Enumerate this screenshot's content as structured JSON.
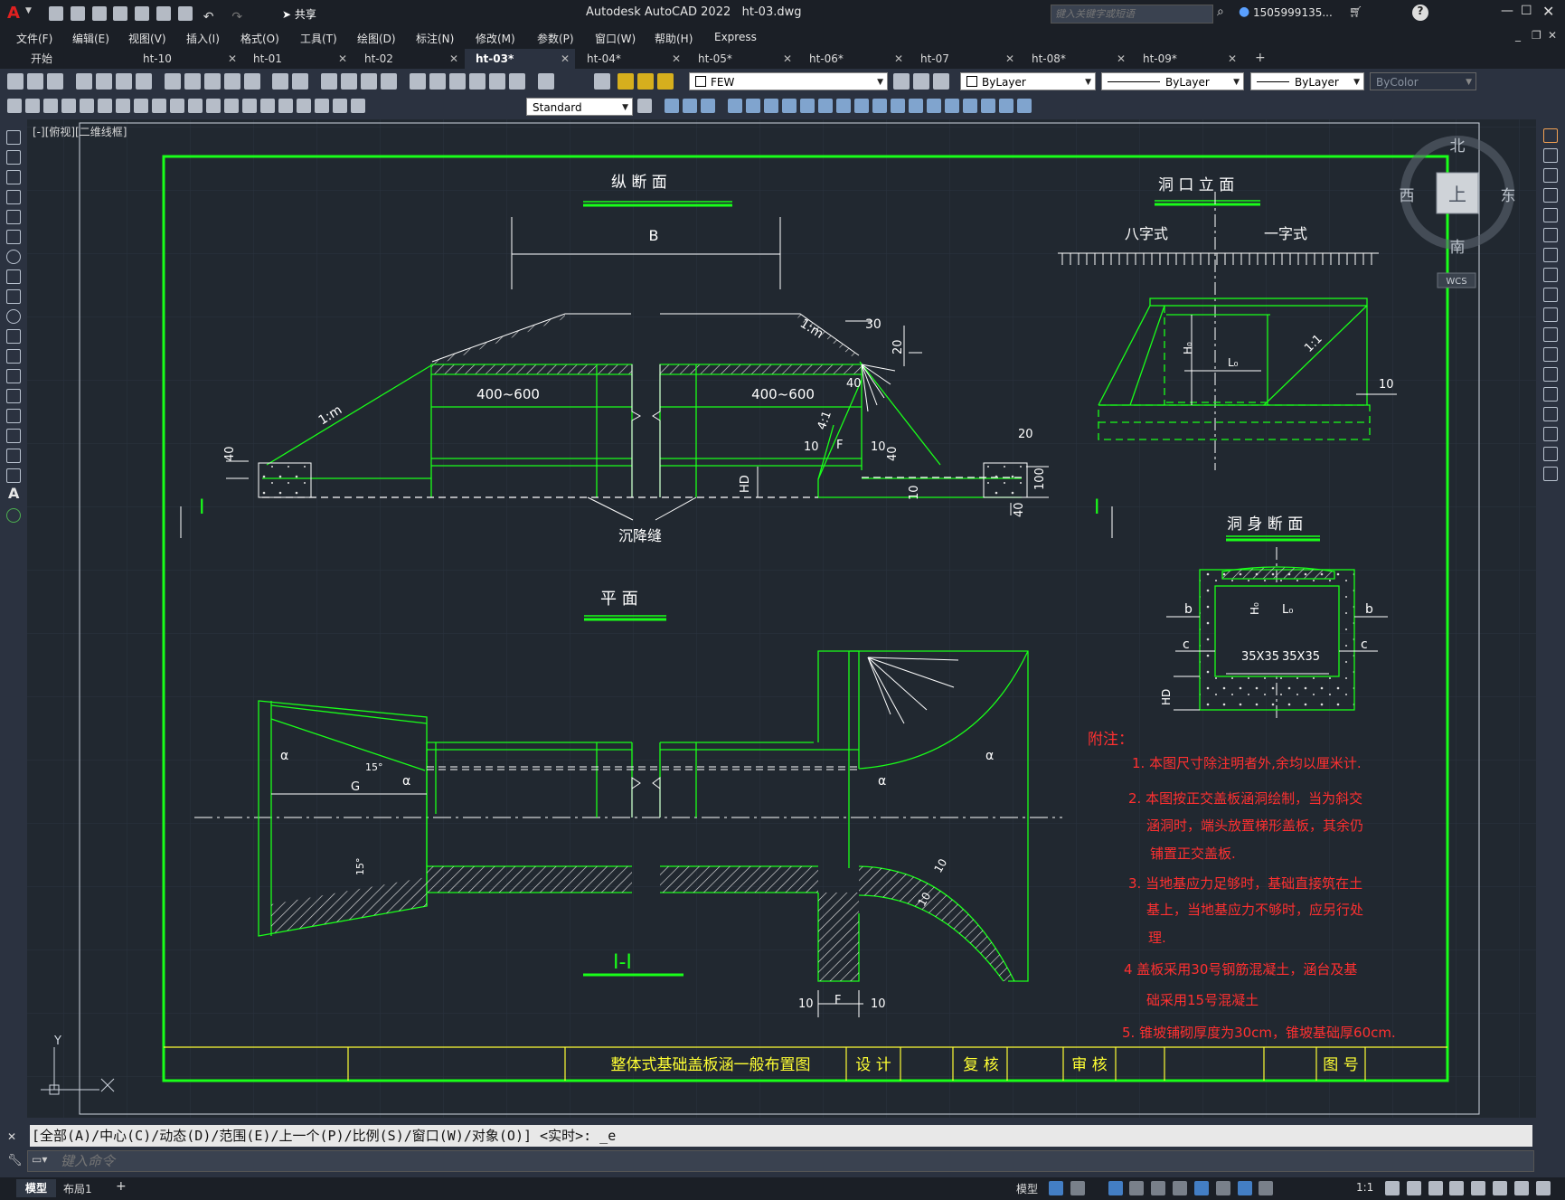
{
  "app": {
    "title": "Autodesk AutoCAD 2022",
    "filename": "ht-03.dwg",
    "share_label": "共享",
    "search_placeholder": "键入关键字或短语",
    "user": "1505999135...",
    "help": "?"
  },
  "menu": [
    "文件(F)",
    "编辑(E)",
    "视图(V)",
    "插入(I)",
    "格式(O)",
    "工具(T)",
    "绘图(D)",
    "标注(N)",
    "修改(M)",
    "参数(P)",
    "窗口(W)",
    "帮助(H)",
    "Express"
  ],
  "tabs": [
    {
      "label": "开始",
      "closable": false,
      "active": false
    },
    {
      "label": "ht-10",
      "closable": true,
      "active": false
    },
    {
      "label": "ht-01",
      "closable": true,
      "active": false
    },
    {
      "label": "ht-02",
      "closable": true,
      "active": false
    },
    {
      "label": "ht-03*",
      "closable": true,
      "active": true
    },
    {
      "label": "ht-04*",
      "closable": true,
      "active": false
    },
    {
      "label": "ht-05*",
      "closable": true,
      "active": false
    },
    {
      "label": "ht-06*",
      "closable": true,
      "active": false
    },
    {
      "label": "ht-07",
      "closable": true,
      "active": false
    },
    {
      "label": "ht-08*",
      "closable": true,
      "active": false
    },
    {
      "label": "ht-09*",
      "closable": true,
      "active": false
    }
  ],
  "layers": {
    "current_layer": "FEW",
    "color": "ByLayer",
    "linetype": "ByLayer",
    "lineweight": "ByLayer",
    "plotstyle": "ByColor",
    "text_style": "Standard"
  },
  "viewport": {
    "label": "[-][俯视][二维线框]",
    "viewcube": {
      "north": "北",
      "south": "南",
      "east": "东",
      "west": "西",
      "top": "上",
      "wcs": "WCS"
    },
    "ucs_y": "Y",
    "ucs_x": "X"
  },
  "drawing": {
    "section_long": "纵  断  面",
    "section_portal": "洞  口  立  面",
    "section_plan": "平  面",
    "section_body": "洞  身  断  面",
    "section_ii": "I-I",
    "eight_type": "八字式",
    "one_type": "一字式",
    "B": "B",
    "d400_600": "400~600",
    "slope_1m": "1:m",
    "slope_41": "4:1",
    "slope_11": "1:1",
    "d30": "30",
    "d20": "20",
    "d40": "40",
    "d10": "10",
    "d100": "100",
    "F": "F",
    "HD": "HD",
    "H0": "H₀",
    "L0": "L₀",
    "b": "b",
    "c": "c",
    "chamfer": "35X35",
    "settle_joint": "沉降缝",
    "I": "I",
    "deg15": "15°",
    "G": "G",
    "alpha": "α",
    "notes_title": "附注：",
    "notes": [
      "1. 本图尺寸除注明者外,余均以厘米计.",
      "2. 本图按正交盖板涵洞绘制，当为斜交",
      "涵洞时，端头放置梯形盖板，其余仍",
      "铺置正交盖板.",
      "3. 当地基应力足够时，基础直接筑在土",
      "基上，当地基应力不够时，应另行处",
      "理.",
      "4 盖板采用30号钢筋混凝土，涵台及基",
      "础采用15号混凝土",
      "5. 锥坡铺砌厚度为30cm，锥坡基础厚60cm."
    ],
    "titleblock": {
      "name": "整体式基础盖板涵一般布置图",
      "design": "设  计",
      "review": "复  核",
      "approve": "审  核",
      "drawing_no": "图  号"
    }
  },
  "command": {
    "history": "[全部(A)/中心(C)/动态(D)/范围(E)/上一个(P)/比例(S)/窗口(W)/对象(O)] <实时>: _e",
    "placeholder": "键入命令"
  },
  "status": {
    "model_tab": "模型",
    "layout_tab": "布局1",
    "add_tab": "+",
    "model_label": "模型",
    "scale": "1:1"
  }
}
